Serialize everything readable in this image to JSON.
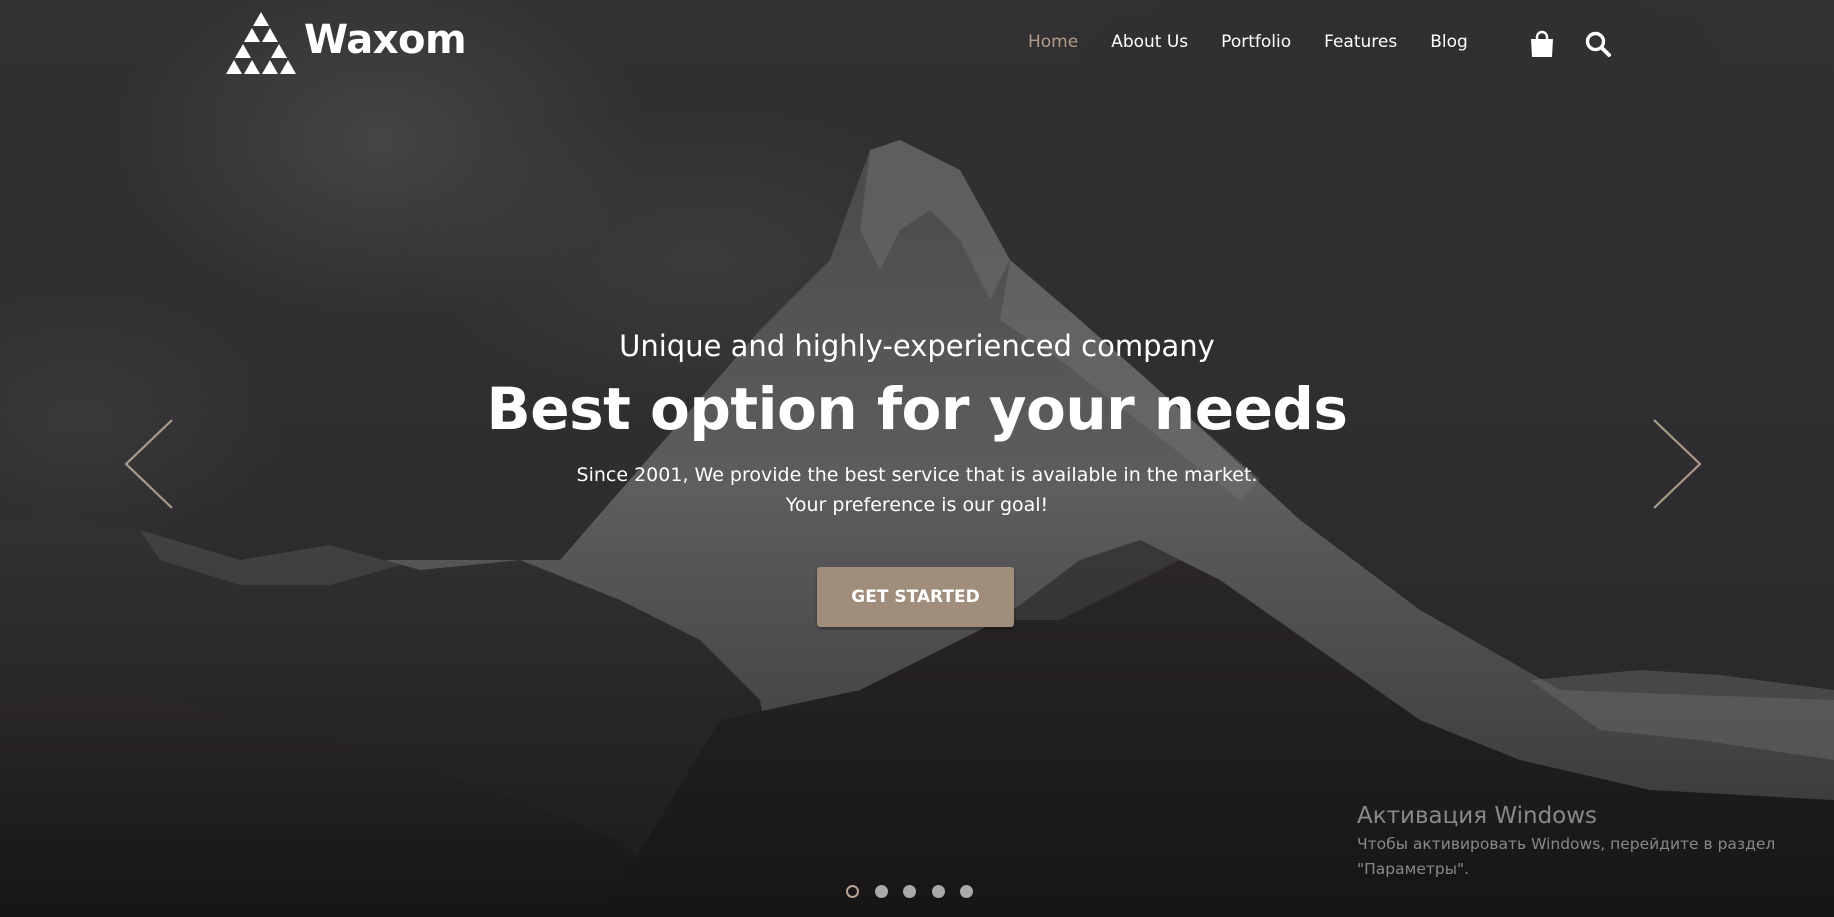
{
  "brand": {
    "name": "Waxom",
    "accent_color": "#a18d7b",
    "active_nav_color": "#b19c89"
  },
  "nav": {
    "items": [
      {
        "label": "Home",
        "active": true
      },
      {
        "label": "About Us",
        "active": false
      },
      {
        "label": "Portfolio",
        "active": false
      },
      {
        "label": "Features",
        "active": false
      },
      {
        "label": "Blog",
        "active": false
      }
    ],
    "icons": [
      "shopping-bag-icon",
      "search-icon"
    ]
  },
  "hero": {
    "subtitle": "Unique and highly-experienced company",
    "title": "Best option for your needs",
    "description_line1": "Since 2001, We provide the best service that is available in the market.",
    "description_line2": "Your preference is our goal!",
    "cta_label": "GET STARTED"
  },
  "slider": {
    "prev_icon": "chevron-left-icon",
    "next_icon": "chevron-right-icon",
    "slide_count": 5,
    "active_slide": 1
  },
  "watermark": {
    "title": "Активация Windows",
    "line1": "Чтобы активировать Windows, перейдите в раздел",
    "line2": "\"Параметры\"."
  }
}
